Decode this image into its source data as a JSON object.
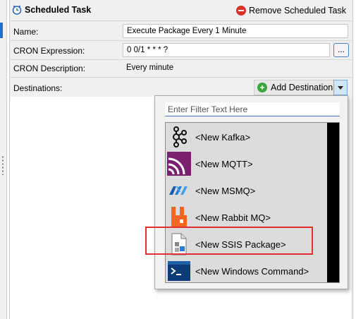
{
  "task": {
    "title": "Scheduled Task",
    "remove_label": "Remove Scheduled Task"
  },
  "form": {
    "name_label": "Name:",
    "name_value": "Execute Package Every 1 Minute",
    "cron_label": "CRON Expression:",
    "cron_value": "0 0/1 * * * ?",
    "cron_button": "...",
    "desc_label": "CRON Description:",
    "desc_value": "Every minute",
    "dest_label": "Destinations:",
    "add_dest_label": "Add Destination"
  },
  "popup": {
    "filter_placeholder": "Enter Filter Text Here",
    "items": [
      {
        "label": "<New Kafka>",
        "icon": "kafka-icon"
      },
      {
        "label": "<New MQTT>",
        "icon": "mqtt-icon"
      },
      {
        "label": "<New MSMQ>",
        "icon": "msmq-icon"
      },
      {
        "label": "<New Rabbit MQ>",
        "icon": "rabbitmq-icon"
      },
      {
        "label": "<New SSIS Package>",
        "icon": "ssis-package-icon"
      },
      {
        "label": "<New Windows Command>",
        "icon": "windows-command-icon"
      }
    ]
  },
  "colors": {
    "remove": "#d9322b",
    "add": "#3aa53a",
    "highlight": "#e03030",
    "mqtt": "#7b1f6e",
    "rabbit": "#f26522"
  }
}
